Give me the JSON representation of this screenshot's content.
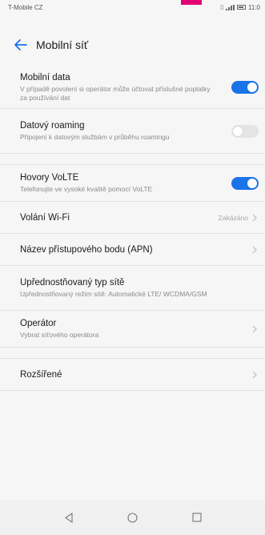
{
  "status_bar": {
    "carrier": "T-Mobile CZ",
    "time": "11:0"
  },
  "header": {
    "title": "Mobilní síť",
    "back_icon": "arrow-left-icon"
  },
  "colors": {
    "accent": "#1a73e8",
    "brand_magenta": "#e20074"
  },
  "settings": [
    {
      "title": "Mobilní data",
      "subtitle": "V případě povolení si operátor může účtovat příslušné poplatky za používání dat",
      "toggle": true
    },
    {
      "title": "Datový roaming",
      "subtitle": "Připojení k datovým službám v průběhu roamingu",
      "toggle": false
    },
    {
      "title": "Hovory VoLTE",
      "subtitle": "Telefonujte ve vysoké kvalitě pomocí VoLTE",
      "toggle": true
    },
    {
      "title": "Volání Wi-Fi",
      "value": "Zakázáno"
    },
    {
      "title": "Název přístupového bodu (APN)"
    },
    {
      "title": "Upřednostňovaný typ sítě",
      "subtitle": "Upřednostňovaný režim sítě: Automatické LTE/ WCDMA/GSM"
    },
    {
      "title": "Operátor",
      "subtitle": "Vybrat síťového operátora"
    },
    {
      "title": "Rozšířené"
    }
  ],
  "nav_bar": {
    "back": "triangle-back-icon",
    "home": "circle-home-icon",
    "recents": "square-recents-icon"
  }
}
